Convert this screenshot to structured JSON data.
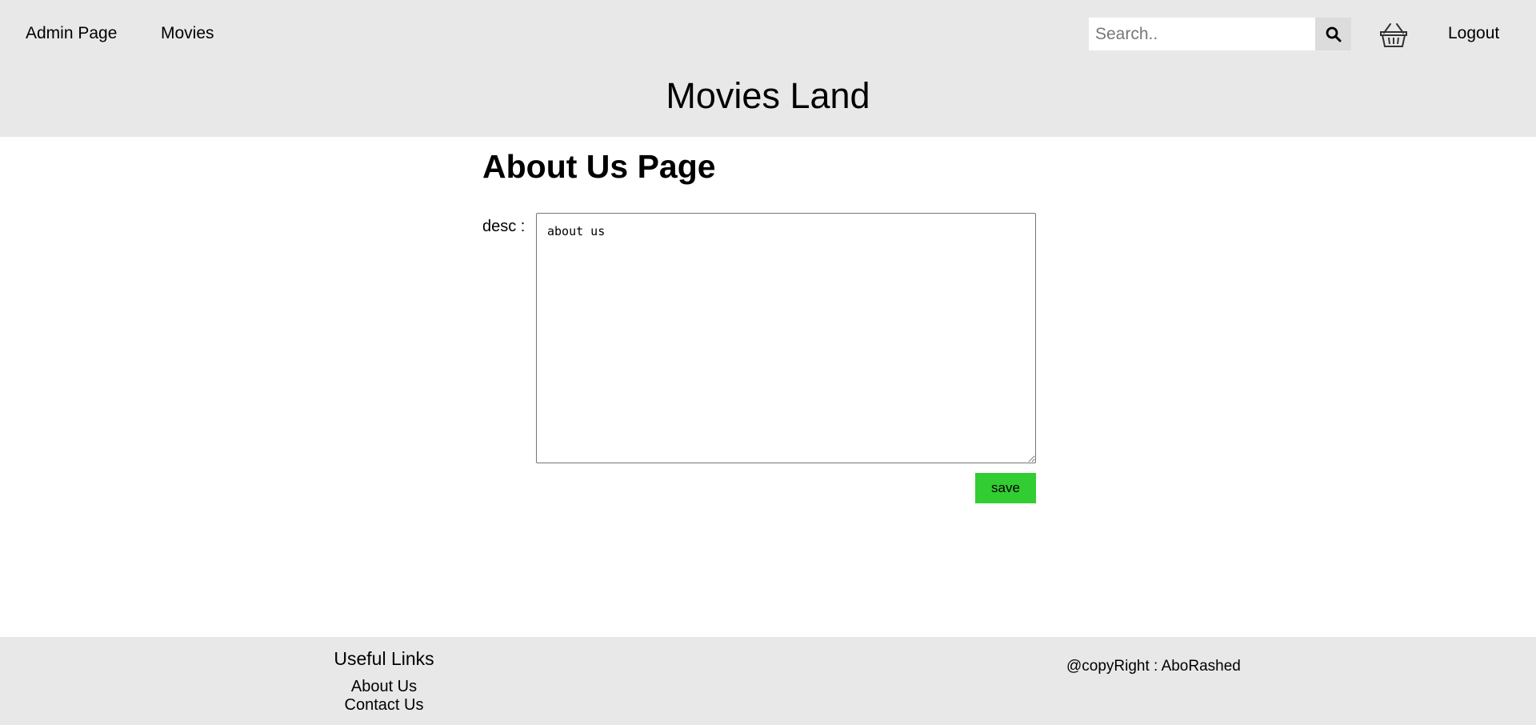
{
  "header": {
    "nav": {
      "admin_label": "Admin Page",
      "movies_label": "Movies",
      "logout_label": "Logout"
    },
    "search": {
      "placeholder": "Search..",
      "value": ""
    },
    "icons": {
      "search": "search-icon",
      "basket": "basket-icon"
    },
    "site_title": "Movies Land"
  },
  "main": {
    "heading": "About Us Page",
    "desc_label": "desc :",
    "desc_value": "about us",
    "save_label": "save"
  },
  "footer": {
    "useful_links_title": "Useful Links",
    "links": [
      "About Us",
      "Contact Us"
    ],
    "copyright": "@copyRight : AboRashed"
  },
  "colors": {
    "header_bg": "#e8e8e8",
    "save_button": "#32cd32"
  }
}
